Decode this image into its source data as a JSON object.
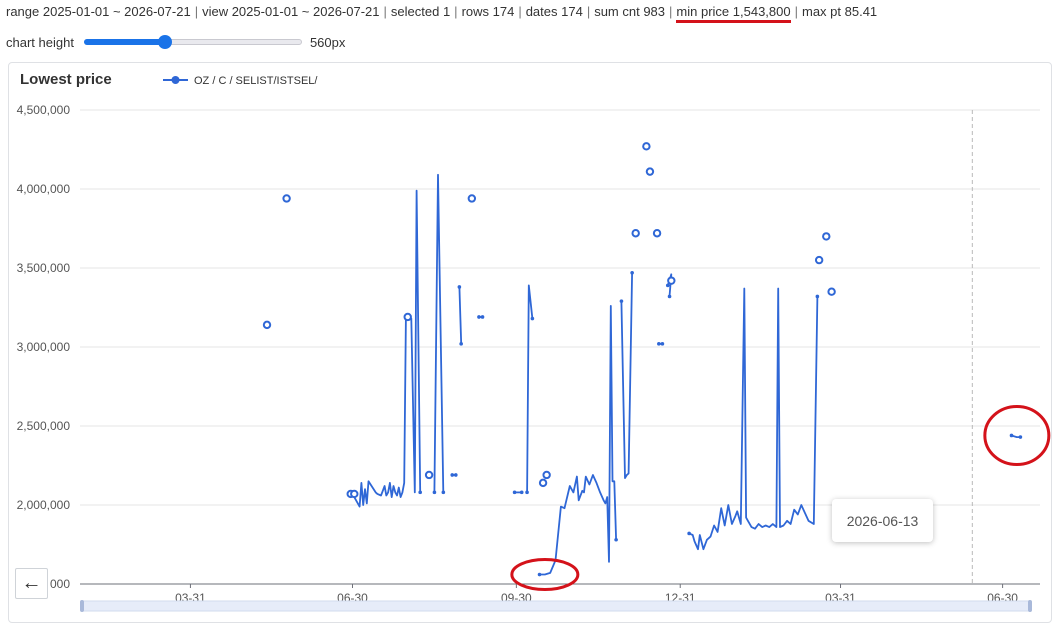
{
  "status_bar": {
    "range": "range 2025-01-01 ~ 2026-07-21",
    "view": "view 2025-01-01 ~ 2026-07-21",
    "selected": "selected 1",
    "rows": "rows 174",
    "dates": "dates 174",
    "sum_cnt": "sum cnt 983",
    "min_price": "min price 1,543,800",
    "max_pt": "max pt 85.41",
    "separator": "|"
  },
  "controls": {
    "chart_height_label": "chart height",
    "chart_height_value": "560px",
    "chart_height_fraction": 0.37
  },
  "back_button": {
    "icon": "arrow-left-icon",
    "glyph": "←"
  },
  "tooltip": {
    "date": "2026-06-13"
  },
  "colors": {
    "series": "#2f67d6",
    "accent": "#1a73e8",
    "annotation": "#d4121a",
    "grid": "#e6e6e6"
  },
  "chart_data": {
    "type": "line",
    "title": "Lowest price",
    "xlabel": "",
    "ylabel": "",
    "ylim": [
      1500000,
      4500000
    ],
    "xlim": [
      "2025-01-28",
      "2026-07-21"
    ],
    "y_ticks": [
      {
        "value": 1500000,
        "label": "000"
      },
      {
        "value": 2000000,
        "label": "2,000,000"
      },
      {
        "value": 2500000,
        "label": "2,500,000"
      },
      {
        "value": 3000000,
        "label": "3,000,000"
      },
      {
        "value": 3500000,
        "label": "3,500,000"
      },
      {
        "value": 4000000,
        "label": "4,000,000"
      },
      {
        "value": 4500000,
        "label": "4,500,000"
      }
    ],
    "x_ticks": [
      {
        "date": "2025-03-31",
        "label": "03-31"
      },
      {
        "date": "2025-06-30",
        "label": "06-30"
      },
      {
        "date": "2025-09-30",
        "label": "09-30"
      },
      {
        "date": "2025-12-31",
        "label": "12-31"
      },
      {
        "date": "2026-03-31",
        "label": "03-31"
      },
      {
        "date": "2026-06-30",
        "label": "06-30"
      }
    ],
    "grid": true,
    "legend_position": "top-left",
    "crosshair_date": "2026-06-13",
    "series": [
      {
        "name": "OZ / C / SELIST/ISTSEL/",
        "color": "#2f67d6",
        "segments": [
          [
            [
              "2025-06-30",
              2070000
            ],
            [
              "2025-07-04",
              1990000
            ],
            [
              "2025-07-05",
              2140000
            ],
            [
              "2025-07-06",
              2000000
            ],
            [
              "2025-07-07",
              2100000
            ],
            [
              "2025-07-08",
              2010000
            ],
            [
              "2025-07-09",
              2150000
            ],
            [
              "2025-07-13",
              2080000
            ],
            [
              "2025-07-14",
              2070000
            ],
            [
              "2025-07-16",
              2060000
            ],
            [
              "2025-07-18",
              2120000
            ],
            [
              "2025-07-19",
              2060000
            ],
            [
              "2025-07-20",
              2080000
            ],
            [
              "2025-07-21",
              2140000
            ],
            [
              "2025-07-22",
              2050000
            ],
            [
              "2025-07-23",
              2120000
            ],
            [
              "2025-07-24",
              2080000
            ],
            [
              "2025-07-25",
              2060000
            ],
            [
              "2025-07-26",
              2110000
            ],
            [
              "2025-07-27",
              2050000
            ],
            [
              "2025-07-28",
              2080000
            ],
            [
              "2025-07-29",
              2140000
            ],
            [
              "2025-07-30",
              3180000
            ],
            [
              "2025-08-01",
              3190000
            ],
            [
              "2025-08-02",
              3180000
            ],
            [
              "2025-08-04",
              2080000
            ],
            [
              "2025-08-05",
              3990000
            ],
            [
              "2025-08-07",
              2080000
            ]
          ],
          [
            [
              "2025-08-15",
              2080000
            ],
            [
              "2025-08-17",
              4090000
            ],
            [
              "2025-08-20",
              2080000
            ]
          ],
          [
            [
              "2025-08-25",
              2190000
            ],
            [
              "2025-08-27",
              2190000
            ]
          ],
          [
            [
              "2025-08-29",
              3380000
            ],
            [
              "2025-08-30",
              3020000
            ]
          ],
          [
            [
              "2025-09-09",
              3190000
            ],
            [
              "2025-09-11",
              3190000
            ]
          ],
          [
            [
              "2025-09-29",
              2080000
            ],
            [
              "2025-10-03",
              2080000
            ]
          ],
          [
            [
              "2025-10-06",
              2080000
            ],
            [
              "2025-10-07",
              3390000
            ],
            [
              "2025-10-09",
              3180000
            ]
          ],
          [
            [
              "2025-10-13",
              1560000
            ],
            [
              "2025-10-16",
              1560000
            ],
            [
              "2025-10-19",
              1570000
            ],
            [
              "2025-10-22",
              1650000
            ],
            [
              "2025-10-25",
              1990000
            ],
            [
              "2025-10-27",
              1980000
            ],
            [
              "2025-10-30",
              2120000
            ],
            [
              "2025-11-01",
              2080000
            ],
            [
              "2025-11-03",
              2180000
            ],
            [
              "2025-11-04",
              2030000
            ],
            [
              "2025-11-06",
              2090000
            ],
            [
              "2025-11-07",
              2080000
            ],
            [
              "2025-11-08",
              2180000
            ],
            [
              "2025-11-10",
              2130000
            ],
            [
              "2025-11-12",
              2190000
            ],
            [
              "2025-11-14",
              2140000
            ],
            [
              "2025-11-16",
              2080000
            ],
            [
              "2025-11-18",
              2030000
            ],
            [
              "2025-11-19",
              2010000
            ],
            [
              "2025-11-20",
              2050000
            ],
            [
              "2025-11-21",
              1640000
            ],
            [
              "2025-11-22",
              3260000
            ],
            [
              "2025-11-23",
              2150000
            ],
            [
              "2025-11-24",
              2150000
            ],
            [
              "2025-11-25",
              1780000
            ]
          ],
          [
            [
              "2025-11-28",
              3290000
            ],
            [
              "2025-11-30",
              2170000
            ],
            [
              "2025-12-01",
              2190000
            ],
            [
              "2025-12-02",
              2200000
            ],
            [
              "2025-12-04",
              3470000
            ]
          ],
          [
            [
              "2025-12-19",
              3020000
            ],
            [
              "2025-12-21",
              3020000
            ]
          ],
          [
            [
              "2025-12-24",
              3390000
            ],
            [
              "2025-12-26",
              3460000
            ],
            [
              "2025-12-25",
              3320000
            ]
          ],
          [
            [
              "2026-01-05",
              1820000
            ],
            [
              "2026-01-07",
              1810000
            ],
            [
              "2026-01-08",
              1770000
            ],
            [
              "2026-01-10",
              1720000
            ],
            [
              "2026-01-11",
              1810000
            ],
            [
              "2026-01-13",
              1720000
            ],
            [
              "2026-01-15",
              1780000
            ],
            [
              "2026-01-17",
              1800000
            ],
            [
              "2026-01-19",
              1870000
            ],
            [
              "2026-01-21",
              1830000
            ],
            [
              "2026-01-23",
              1980000
            ],
            [
              "2026-01-25",
              1870000
            ],
            [
              "2026-01-27",
              2000000
            ],
            [
              "2026-01-29",
              1880000
            ],
            [
              "2026-01-31",
              1930000
            ],
            [
              "2026-02-01",
              1960000
            ],
            [
              "2026-02-03",
              1880000
            ],
            [
              "2026-02-05",
              3370000
            ],
            [
              "2026-02-06",
              1920000
            ],
            [
              "2026-02-07",
              1900000
            ],
            [
              "2026-02-09",
              1860000
            ],
            [
              "2026-02-11",
              1850000
            ],
            [
              "2026-02-13",
              1880000
            ],
            [
              "2026-02-15",
              1860000
            ],
            [
              "2026-02-17",
              1870000
            ],
            [
              "2026-02-19",
              1860000
            ],
            [
              "2026-02-21",
              1880000
            ],
            [
              "2026-02-23",
              1860000
            ],
            [
              "2026-02-24",
              3370000
            ],
            [
              "2026-02-25",
              1860000
            ],
            [
              "2026-02-27",
              1870000
            ],
            [
              "2026-03-01",
              1900000
            ],
            [
              "2026-03-03",
              1880000
            ],
            [
              "2026-03-05",
              1970000
            ],
            [
              "2026-03-07",
              1940000
            ],
            [
              "2026-03-09",
              2000000
            ],
            [
              "2026-03-11",
              1950000
            ],
            [
              "2026-03-13",
              1900000
            ],
            [
              "2026-03-16",
              1880000
            ],
            [
              "2026-03-18",
              3320000
            ]
          ],
          [
            [
              "2026-07-05",
              2440000
            ],
            [
              "2026-07-08",
              2430000
            ],
            [
              "2026-07-10",
              2430000
            ]
          ]
        ],
        "isolated_points": [
          [
            "2025-05-13",
            3140000
          ],
          [
            "2025-05-24",
            3940000
          ],
          [
            "2025-06-29",
            2070000
          ],
          [
            "2025-07-01",
            2070000
          ],
          [
            "2025-07-31",
            3190000
          ],
          [
            "2025-08-12",
            2190000
          ],
          [
            "2025-09-05",
            3940000
          ],
          [
            "2025-10-15",
            2140000
          ],
          [
            "2025-10-17",
            2190000
          ],
          [
            "2025-12-06",
            3720000
          ],
          [
            "2025-12-12",
            4270000
          ],
          [
            "2025-12-14",
            4110000
          ],
          [
            "2025-12-18",
            3720000
          ],
          [
            "2025-12-26",
            3420000
          ],
          [
            "2026-03-19",
            3550000
          ],
          [
            "2026-03-23",
            3700000
          ],
          [
            "2026-03-26",
            3350000
          ]
        ]
      }
    ],
    "annotations": [
      {
        "type": "ellipse",
        "date": "2025-10-16",
        "value": 1560000,
        "color": "#d4121a"
      },
      {
        "type": "ellipse",
        "date": "2026-07-08",
        "value": 2440000,
        "color": "#d4121a"
      }
    ]
  }
}
